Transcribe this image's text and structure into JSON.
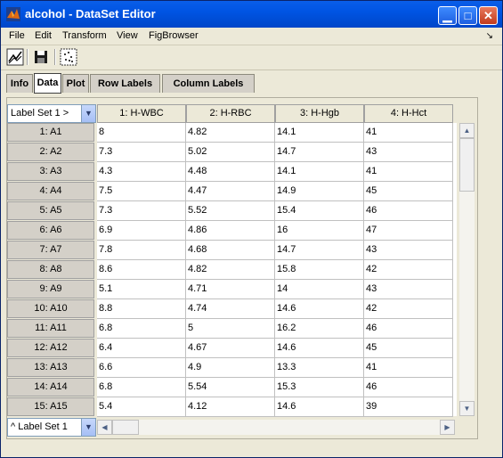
{
  "window": {
    "title": "alcohol - DataSet Editor"
  },
  "menu": [
    "File",
    "Edit",
    "Transform",
    "View",
    "FigBrowser"
  ],
  "toolbar": {
    "icons": [
      "chart-icon",
      "save-icon",
      "scatter-icon"
    ]
  },
  "tabs": [
    "Info",
    "Data",
    "Plot",
    "Row Labels",
    "Column Labels"
  ],
  "active_tab": "Data",
  "label_set_top": "Label Set 1 >",
  "label_set_bottom": "^ Label Set 1",
  "columns": [
    "1: H-WBC",
    "2: H-RBC",
    "3: H-Hgb",
    "4: H-Hct"
  ],
  "rows": [
    {
      "label": "1: A1",
      "values": [
        "8",
        "4.82",
        "14.1",
        "41"
      ]
    },
    {
      "label": "2: A2",
      "values": [
        "7.3",
        "5.02",
        "14.7",
        "43"
      ]
    },
    {
      "label": "3: A3",
      "values": [
        "4.3",
        "4.48",
        "14.1",
        "41"
      ]
    },
    {
      "label": "4: A4",
      "values": [
        "7.5",
        "4.47",
        "14.9",
        "45"
      ]
    },
    {
      "label": "5: A5",
      "values": [
        "7.3",
        "5.52",
        "15.4",
        "46"
      ]
    },
    {
      "label": "6: A6",
      "values": [
        "6.9",
        "4.86",
        "16",
        "47"
      ]
    },
    {
      "label": "7: A7",
      "values": [
        "7.8",
        "4.68",
        "14.7",
        "43"
      ]
    },
    {
      "label": "8: A8",
      "values": [
        "8.6",
        "4.82",
        "15.8",
        "42"
      ]
    },
    {
      "label": "9: A9",
      "values": [
        "5.1",
        "4.71",
        "14",
        "43"
      ]
    },
    {
      "label": "10: A10",
      "values": [
        "8.8",
        "4.74",
        "14.6",
        "42"
      ]
    },
    {
      "label": "11: A11",
      "values": [
        "6.8",
        "5",
        "16.2",
        "46"
      ]
    },
    {
      "label": "12: A12",
      "values": [
        "6.4",
        "4.67",
        "14.6",
        "45"
      ]
    },
    {
      "label": "13: A13",
      "values": [
        "6.6",
        "4.9",
        "13.3",
        "41"
      ]
    },
    {
      "label": "14: A14",
      "values": [
        "6.8",
        "5.54",
        "15.3",
        "46"
      ]
    },
    {
      "label": "15: A15",
      "values": [
        "5.4",
        "4.12",
        "14.6",
        "39"
      ]
    }
  ]
}
